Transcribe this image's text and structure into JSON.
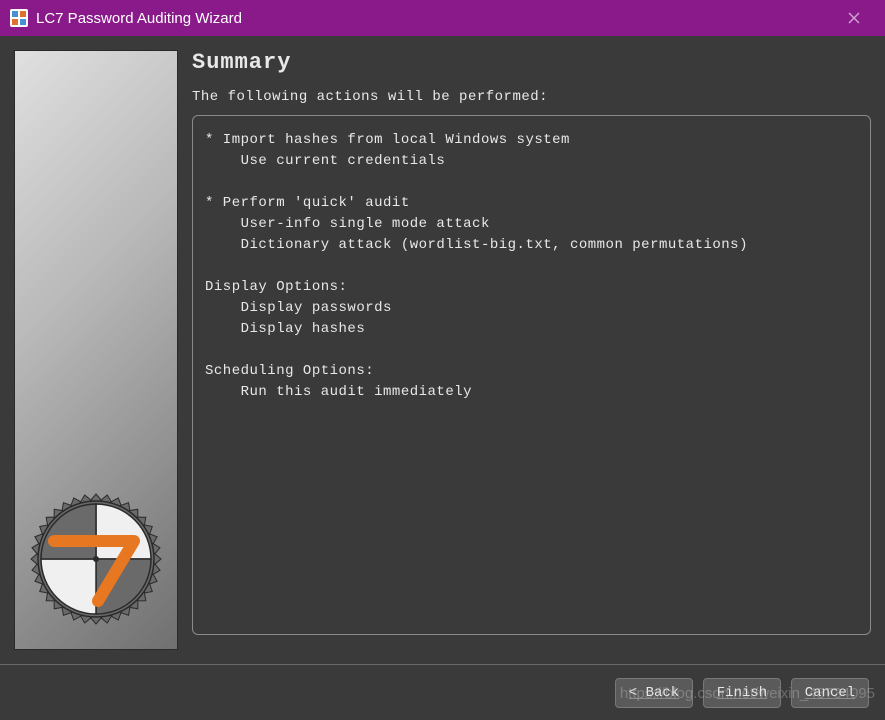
{
  "window": {
    "title": "LC7 Password Auditing Wizard"
  },
  "content": {
    "heading": "Summary",
    "subheading": "The following actions will be performed:",
    "summary_text": "* Import hashes from local Windows system\n    Use current credentials\n\n* Perform 'quick' audit\n    User-info single mode attack\n    Dictionary attack (wordlist-big.txt, common permutations)\n\nDisplay Options:\n    Display passwords\n    Display hashes\n\nScheduling Options:\n    Run this audit immediately"
  },
  "buttons": {
    "back": "< Back",
    "finish": "Finish",
    "cancel": "Cancel"
  },
  "watermark": "https://blog.csdn.net/weixin_43734095"
}
